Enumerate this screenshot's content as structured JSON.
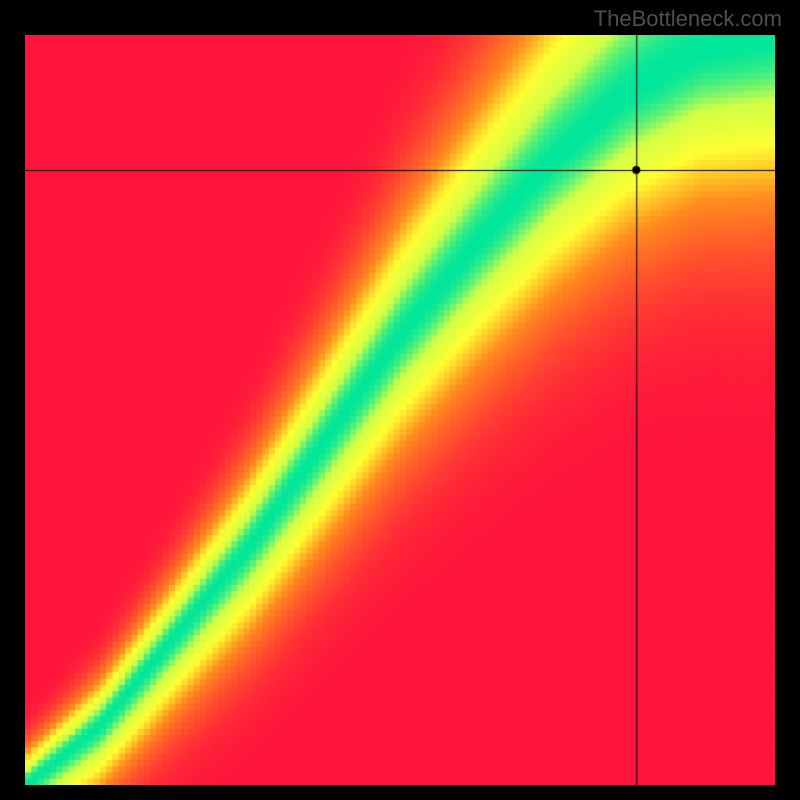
{
  "watermark": "TheBottleneck.com",
  "chart_data": {
    "type": "heatmap",
    "title": "",
    "xlabel": "",
    "ylabel": "",
    "xlim": [
      0,
      1
    ],
    "ylim": [
      0,
      1
    ],
    "legend": false,
    "pixelated": true,
    "grid_resolution": 120,
    "colormap_stops": [
      {
        "t": 0.0,
        "color": "#ff143c"
      },
      {
        "t": 0.45,
        "color": "#ff8c1e"
      },
      {
        "t": 0.7,
        "color": "#ffff32"
      },
      {
        "t": 0.88,
        "color": "#d2ff46"
      },
      {
        "t": 1.0,
        "color": "#00e69b"
      }
    ],
    "ridge": {
      "description": "Green/yellow ridge of max value running from bottom-left corner toward top-right, curving with slope >1 through middle.",
      "control_points": [
        {
          "x": 0.0,
          "y": 0.0
        },
        {
          "x": 0.1,
          "y": 0.08
        },
        {
          "x": 0.2,
          "y": 0.2
        },
        {
          "x": 0.3,
          "y": 0.32
        },
        {
          "x": 0.4,
          "y": 0.46
        },
        {
          "x": 0.5,
          "y": 0.6
        },
        {
          "x": 0.6,
          "y": 0.72
        },
        {
          "x": 0.7,
          "y": 0.83
        },
        {
          "x": 0.8,
          "y": 0.92
        },
        {
          "x": 0.9,
          "y": 0.98
        },
        {
          "x": 1.0,
          "y": 1.0
        }
      ],
      "width_at_x": [
        {
          "x": 0.0,
          "w": 0.02
        },
        {
          "x": 0.2,
          "w": 0.04
        },
        {
          "x": 0.5,
          "w": 0.08
        },
        {
          "x": 0.8,
          "w": 0.12
        },
        {
          "x": 1.0,
          "w": 0.15
        }
      ]
    },
    "crosshair_point": {
      "x": 0.815,
      "y": 0.82
    },
    "crosshair_style": {
      "stroke": "#000000",
      "width": 1
    },
    "point_marker": {
      "fill": "#000000",
      "radius": 4
    }
  }
}
